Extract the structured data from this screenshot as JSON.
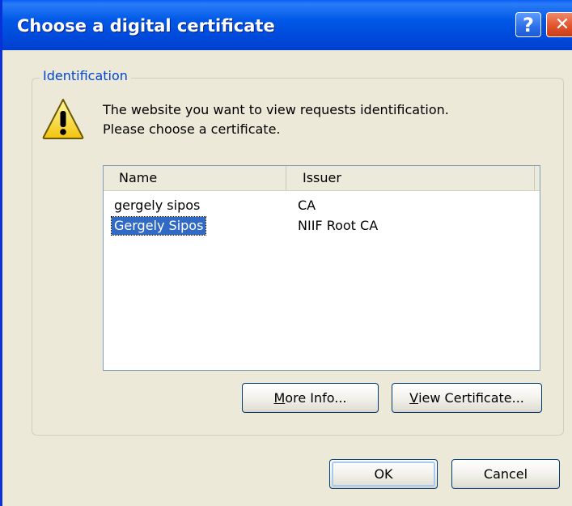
{
  "window": {
    "title": "Choose a digital certificate",
    "help_label": "?",
    "close_label": "✕"
  },
  "group": {
    "label": "Identification"
  },
  "message": {
    "line1": "The website you want to view requests identification.",
    "line2": "Please choose a certificate."
  },
  "list": {
    "columns": [
      "Name",
      "Issuer"
    ],
    "rows": [
      {
        "name": "gergely sipos",
        "issuer": "CA",
        "selected": false
      },
      {
        "name": "Gergely Sipos",
        "issuer": "NIIF Root CA",
        "selected": true
      }
    ]
  },
  "buttons": {
    "more_info": {
      "mnemonic": "M",
      "rest": "ore Info..."
    },
    "view_certificate": {
      "mnemonic": "V",
      "rest": "iew Certificate..."
    },
    "ok": "OK",
    "cancel": "Cancel"
  },
  "icons": {
    "warning": "warning-icon"
  },
  "colors": {
    "titlebar": "#0058e6",
    "dialog_bg": "#ece9d8",
    "selection": "#316ac5",
    "group_label": "#0046d5"
  }
}
